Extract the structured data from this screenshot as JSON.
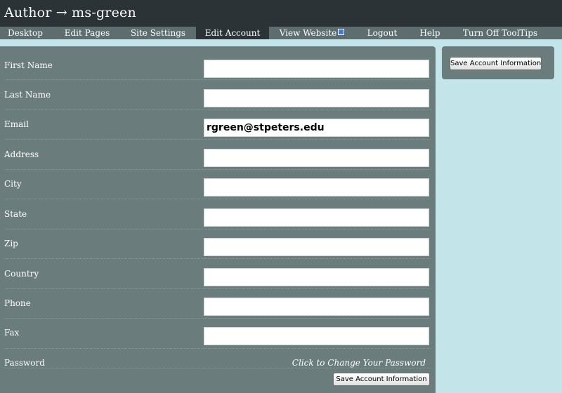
{
  "header": {
    "title": "Author → ms-green"
  },
  "nav": {
    "items": [
      {
        "label": "Desktop"
      },
      {
        "label": "Edit Pages"
      },
      {
        "label": "Site Settings"
      },
      {
        "label": "Edit Account",
        "active": true
      },
      {
        "label": "View Website",
        "icon": "external-link-icon"
      },
      {
        "label": "Logout"
      },
      {
        "label": "Help"
      },
      {
        "label": "Turn Off ToolTips"
      }
    ]
  },
  "form": {
    "fields": [
      {
        "label": "First Name",
        "value": ""
      },
      {
        "label": "Last Name",
        "value": ""
      },
      {
        "label": "Email",
        "value": "rgreen@stpeters.edu"
      },
      {
        "label": "Address",
        "value": ""
      },
      {
        "label": "City",
        "value": ""
      },
      {
        "label": "State",
        "value": ""
      },
      {
        "label": "Zip",
        "value": ""
      },
      {
        "label": "Country",
        "value": ""
      },
      {
        "label": "Phone",
        "value": ""
      },
      {
        "label": "Fax",
        "value": ""
      }
    ],
    "password": {
      "label": "Password",
      "link": "Click to Change Your Password"
    },
    "save_button": "Save Account Information"
  },
  "sidebar": {
    "save_button": "Save Account Information"
  },
  "colors": {
    "page_background": "#c3e5ea",
    "header_background": "#2b3336",
    "nav_background": "#5e6d70",
    "panel_background": "#6b7c7d"
  }
}
